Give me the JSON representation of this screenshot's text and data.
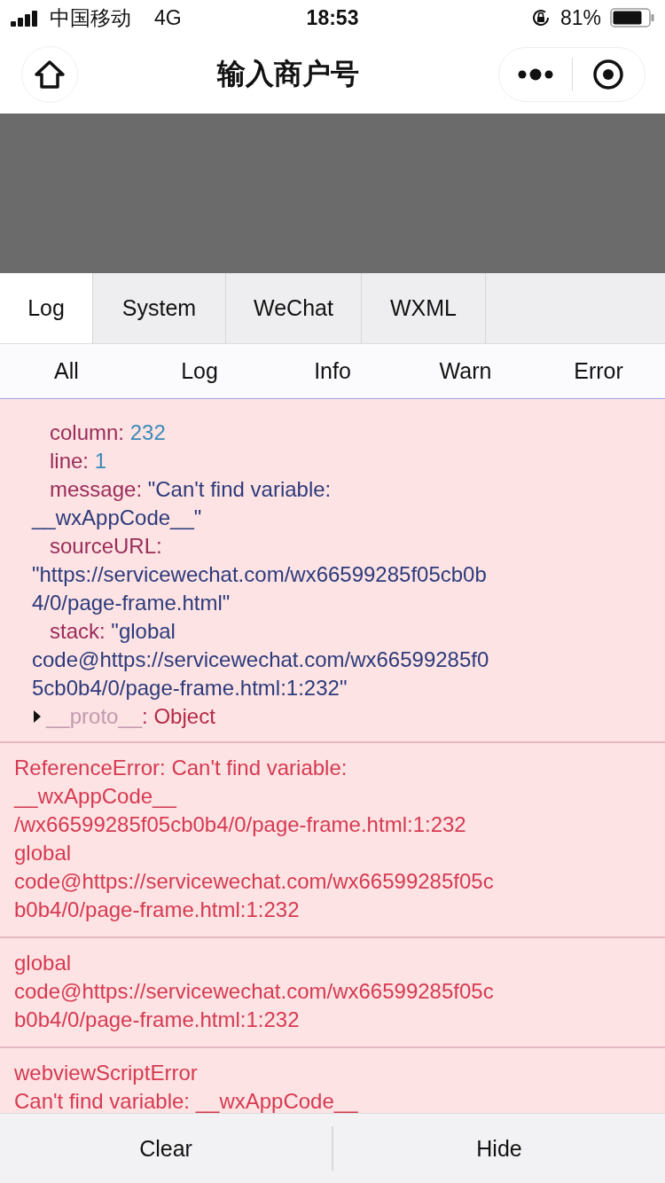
{
  "status_bar": {
    "carrier": "中国移动",
    "network": "4G",
    "time": "18:53",
    "battery": "81%"
  },
  "nav": {
    "title": "输入商户号"
  },
  "tabs": [
    {
      "label": "Log",
      "selected": true
    },
    {
      "label": "System",
      "selected": false
    },
    {
      "label": "WeChat",
      "selected": false
    },
    {
      "label": "WXML",
      "selected": false
    }
  ],
  "filters": [
    {
      "label": "All",
      "selected": false
    },
    {
      "label": "Log",
      "selected": false
    },
    {
      "label": "Info",
      "selected": false
    },
    {
      "label": "Warn",
      "selected": false
    },
    {
      "label": "Error",
      "selected": false
    }
  ],
  "entries": [
    {
      "kind": "object",
      "properties": [
        {
          "key": "column:",
          "inline": "232",
          "kind": "number"
        },
        {
          "key": "line:",
          "inline": "1",
          "kind": "number"
        },
        {
          "key": "message:",
          "inline": "\"Can't find variable:",
          "more": [
            "__wxAppCode__\""
          ],
          "kind": "string"
        },
        {
          "key": "sourceURL:",
          "more": [
            "\"https://servicewechat.com/wx66599285f05cb0b",
            "4/0/page-frame.html\""
          ],
          "kind": "string"
        },
        {
          "key": "stack:",
          "inline": "\"global",
          "more": [
            "code@https://servicewechat.com/wx66599285f0",
            "5cb0b4/0/page-frame.html:1:232\""
          ],
          "kind": "string"
        }
      ],
      "proto": {
        "key": "__proto__",
        "value": ": Object",
        "expanded": false
      }
    },
    {
      "kind": "text",
      "lines": [
        "ReferenceError: Can't find variable:",
        "__wxAppCode__",
        "/wx66599285f05cb0b4/0/page-frame.html:1:232",
        "global",
        "code@https://servicewechat.com/wx66599285f05c",
        "b0b4/0/page-frame.html:1:232"
      ]
    },
    {
      "kind": "text",
      "lines": [
        "global",
        "code@https://servicewechat.com/wx66599285f05c",
        "b0b4/0/page-frame.html:1:232"
      ]
    },
    {
      "kind": "text",
      "lines": [
        "webviewScriptError",
        "Can't find variable: __wxAppCode__"
      ]
    }
  ],
  "actions": [
    "Clear",
    "Hide"
  ]
}
